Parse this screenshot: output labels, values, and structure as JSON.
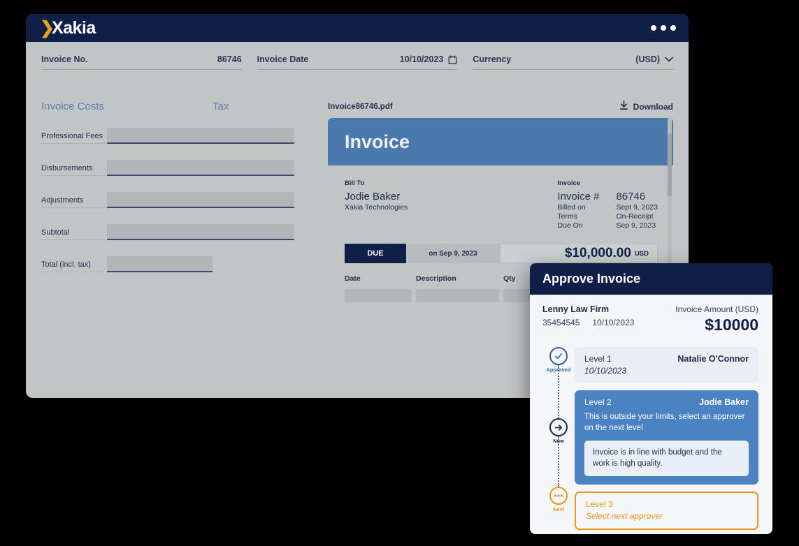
{
  "app": {
    "logo_chevron": "❯",
    "logo_text": "Xakia",
    "window_dots": "•••"
  },
  "fields": [
    {
      "label": "Invoice No.",
      "value": "86746",
      "icon": null
    },
    {
      "label": "Invoice Date",
      "value": "10/10/2023",
      "icon": "calendar-icon"
    },
    {
      "label": "Currency",
      "value": "(USD)",
      "icon": "chevron-down-icon"
    }
  ],
  "costs": {
    "heading_costs": "Invoice Costs",
    "heading_tax": "Tax",
    "rows": [
      {
        "label": "Professional Fees",
        "value": "",
        "tax": "",
        "has_tax": true
      },
      {
        "label": "Disbursements",
        "value": "",
        "tax": "",
        "has_tax": true
      },
      {
        "label": "Adjustments",
        "value": "",
        "tax": "",
        "has_tax": true
      },
      {
        "label": "Subtotal",
        "value": "",
        "tax": "",
        "has_tax": true
      },
      {
        "label": "Total (incl. tax)",
        "value": "",
        "tax": "",
        "has_tax": false
      }
    ]
  },
  "preview": {
    "file_name": "Invoice86746.pdf",
    "download_label": "Download",
    "download_icon": "download-icon",
    "doc": {
      "title": "Invoice",
      "bill_to_label": "Bill To",
      "bill_to_name": "Jodie Baker",
      "bill_to_company": "Xakia Technologies",
      "invoice_label": "Invoice",
      "meta": [
        {
          "key": "Invoice #",
          "value": "86746"
        },
        {
          "key": "Billed on",
          "value": "Sept 9, 2023"
        },
        {
          "key": "Terms",
          "value": "On-Receipt"
        },
        {
          "key": "Due On",
          "value": "Sep 9, 2023"
        }
      ],
      "due_badge": "DUE",
      "due_date": "on Sep 9, 2023",
      "due_amount": "$10,000.00",
      "due_currency": "USD",
      "table_headers": [
        "Date",
        "Description",
        "Qty"
      ]
    }
  },
  "modal": {
    "title": "Approve Invoice",
    "firm": "Lenny Law Firm",
    "firm_number": "35454545",
    "firm_date": "10/10/2023",
    "amount_label": "Invoice Amount (USD)",
    "amount_value": "$10000",
    "steps": [
      {
        "node_icon": "check-circle-icon",
        "node_label": "Approved",
        "level": "Level 1",
        "approver": "Natalie O'Connor",
        "date": "10/10/2023",
        "state": "approved"
      },
      {
        "node_icon": "arrow-right-circle-icon",
        "node_label": "Now",
        "level": "Level 2",
        "approver": "Jodie Baker",
        "message": "This is outside your limits, select an approver on the next level",
        "note": "Invoice is in line with budget and the work is high quality.",
        "state": "current"
      },
      {
        "node_icon": "ellipsis-circle-icon",
        "node_label": "Next",
        "level": "Level 3",
        "placeholder": "Select next approver",
        "state": "next"
      }
    ]
  },
  "colors": {
    "navy": "#0f1f47",
    "brand_orange": "#e8a11c",
    "pdf_header_blue": "#4a79ac",
    "active_blue": "#4a82c4",
    "accent_blue": "#2d5fa6",
    "next_orange": "#f09316",
    "app_bg": "#c2c5c6"
  }
}
